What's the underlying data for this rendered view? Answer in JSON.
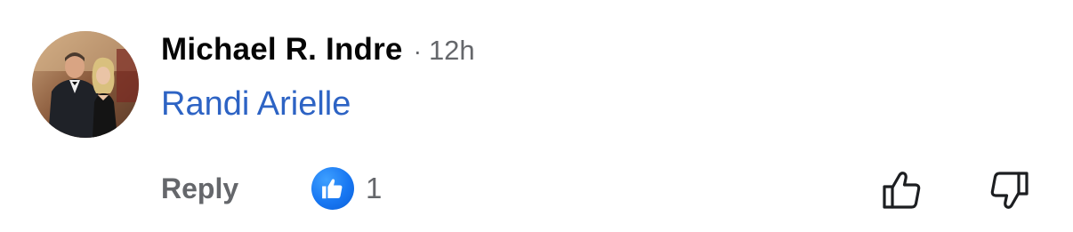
{
  "comment": {
    "author": "Michael R. Indre",
    "separator": "·",
    "timestamp": "12h",
    "body_mention": "Randi Arielle",
    "avatar_icon": "profile-photo",
    "mention_color": "#2d63c4"
  },
  "actions": {
    "reply_label": "Reply",
    "reaction_icon": "like-icon",
    "reaction_count": "1",
    "upvote_icon": "thumbs-up-icon",
    "downvote_icon": "thumbs-down-icon",
    "reaction_color": "#1877f2"
  }
}
